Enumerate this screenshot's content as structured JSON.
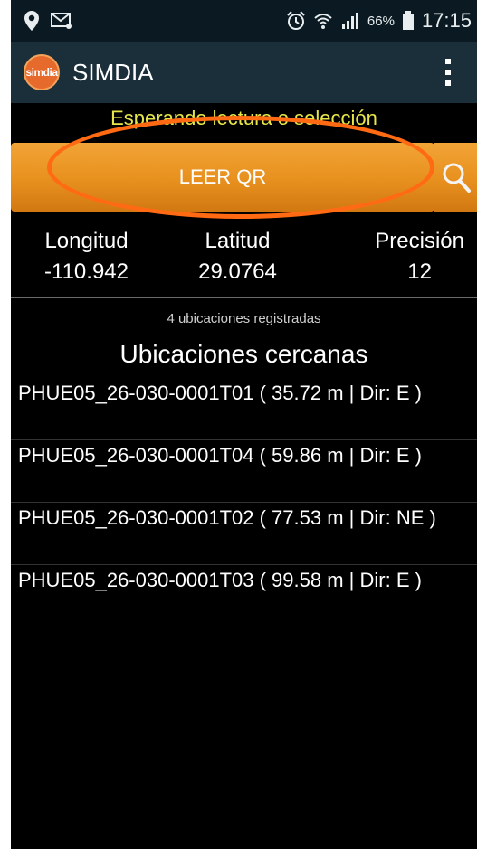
{
  "statusbar": {
    "battery_pct": "66%",
    "time": "17:15",
    "icons": [
      "location-pin-icon",
      "message-icon",
      "alarm-icon",
      "wifi-icon",
      "signal-icon",
      "battery-icon"
    ]
  },
  "app": {
    "logo_text": "simdia",
    "title": "SIMDIA"
  },
  "status_message": "Esperando lectura o selección",
  "scan": {
    "button_label": "LEER QR"
  },
  "coords": {
    "longitude_label": "Longitud",
    "longitude_value": "-110.942",
    "latitude_label": "Latitud",
    "latitude_value": "29.0764",
    "precision_label": "Precisión",
    "precision_value": "12"
  },
  "locations": {
    "count_text": "4 ubicaciones registradas",
    "title": "Ubicaciones cercanas",
    "items": [
      "PHUE05_26-030-0001T01 ( 35.72 m | Dir: E )",
      "PHUE05_26-030-0001T04 ( 59.86 m | Dir: E )",
      "PHUE05_26-030-0001T02 ( 77.53 m | Dir: NE )",
      "PHUE05_26-030-0001T03 ( 99.58 m | Dir: E )"
    ]
  },
  "colors": {
    "accent_orange": "#e7901e",
    "status_yellow": "#e6e64a",
    "highlight": "#ff6a12"
  }
}
